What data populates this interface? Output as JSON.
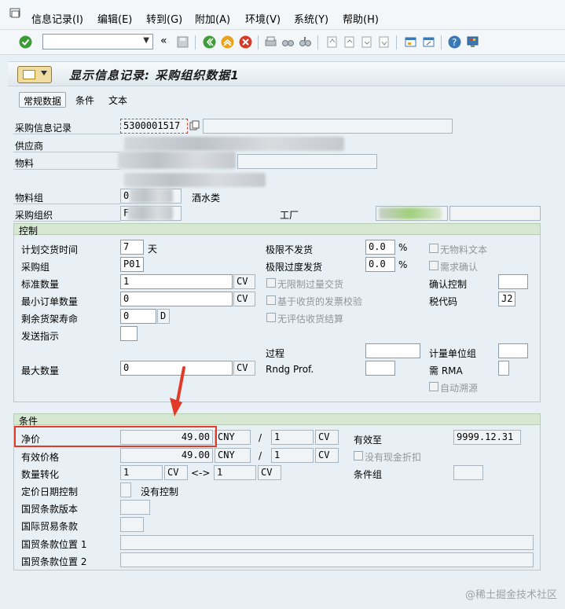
{
  "menu": [
    "信息记录(I)",
    "编辑(E)",
    "转到(G)",
    "附加(A)",
    "环境(V)",
    "系统(Y)",
    "帮助(H)"
  ],
  "screen_title": "显示信息记录: 采购组织数据1",
  "app_buttons": [
    "常规数据",
    "条件",
    "文本"
  ],
  "header": {
    "info_record_label": "采购信息记录",
    "info_record_value": "5300001517",
    "vendor_label": "供应商",
    "material_label": "物料",
    "material_group_label": "物料组",
    "material_group_value": "0",
    "material_group_text": "酒水类",
    "purch_org_label": "采购组织",
    "purch_org_value": "F",
    "plant_label": "工厂"
  },
  "control": {
    "title": "控制",
    "planned_delivery_label": "计划交货时间",
    "planned_delivery_value": "7",
    "planned_delivery_unit": "天",
    "purch_group_label": "采购组",
    "purch_group_value": "P01",
    "std_qty_label": "标准数量",
    "std_qty_value": "1",
    "std_qty_unit": "CV",
    "min_qty_label": "最小订单数量",
    "min_qty_value": "0",
    "min_qty_unit": "CV",
    "shelf_life_label": "剩余货架寿命",
    "shelf_life_value": "0",
    "shelf_life_unit": "D",
    "shipping_label": "发送指示",
    "max_qty_label": "最大数量",
    "max_qty_value": "0",
    "max_qty_unit": "CV",
    "under_tol_label": "极限不发货",
    "under_tol_value": "0.0",
    "over_tol_label": "极限过度发货",
    "over_tol_value": "0.0",
    "percent": "%",
    "unlimited_label": "无限制过量交货",
    "gr_based_iv_label": "基于收货的发票校验",
    "no_eval_gr_label": "无评估收货结算",
    "no_mat_text_label": "无物料文本",
    "ack_required_label": "需求确认",
    "conf_control_label": "确认控制",
    "tax_code_label": "税代码",
    "tax_code_value": "J2",
    "procedure_label": "过程",
    "rndg_label": "Rndg Prof.",
    "uom_group_label": "计量单位组",
    "rma_label": "需 RMA",
    "auto_source_label": "自动溯源"
  },
  "conditions": {
    "title": "条件",
    "net_price_label": "净价",
    "net_price_value": "49.00",
    "net_currency": "CNY",
    "slash": "/",
    "net_per": "1",
    "net_unit": "CV",
    "effective_label": "有效价格",
    "effective_value": "49.00",
    "eff_currency": "CNY",
    "eff_per": "1",
    "eff_unit": "CV",
    "valid_to_label": "有效至",
    "valid_to_value": "9999.12.31",
    "no_cash_disc_label": "没有现金折扣",
    "qty_conv_label": "数量转化",
    "qty_conv_from": "1",
    "qty_conv_from_unit": "CV",
    "qty_conv_arrow": "<->",
    "qty_conv_to": "1",
    "qty_conv_to_unit": "CV",
    "cond_group_label": "条件组",
    "pricing_date_label": "定价日期控制",
    "pricing_date_text": "没有控制",
    "incoterms_version_label": "国贸条款版本",
    "incoterms_label": "国际贸易条款",
    "incoterms_loc1_label": "国贸条款位置 1",
    "incoterms_loc2_label": "国贸条款位置 2"
  },
  "watermark": "@稀土掘金技术社区",
  "colors": {
    "accent_red": "#e03b2a",
    "group_header": "#d7e8d2",
    "background": "#e8f0f5"
  }
}
